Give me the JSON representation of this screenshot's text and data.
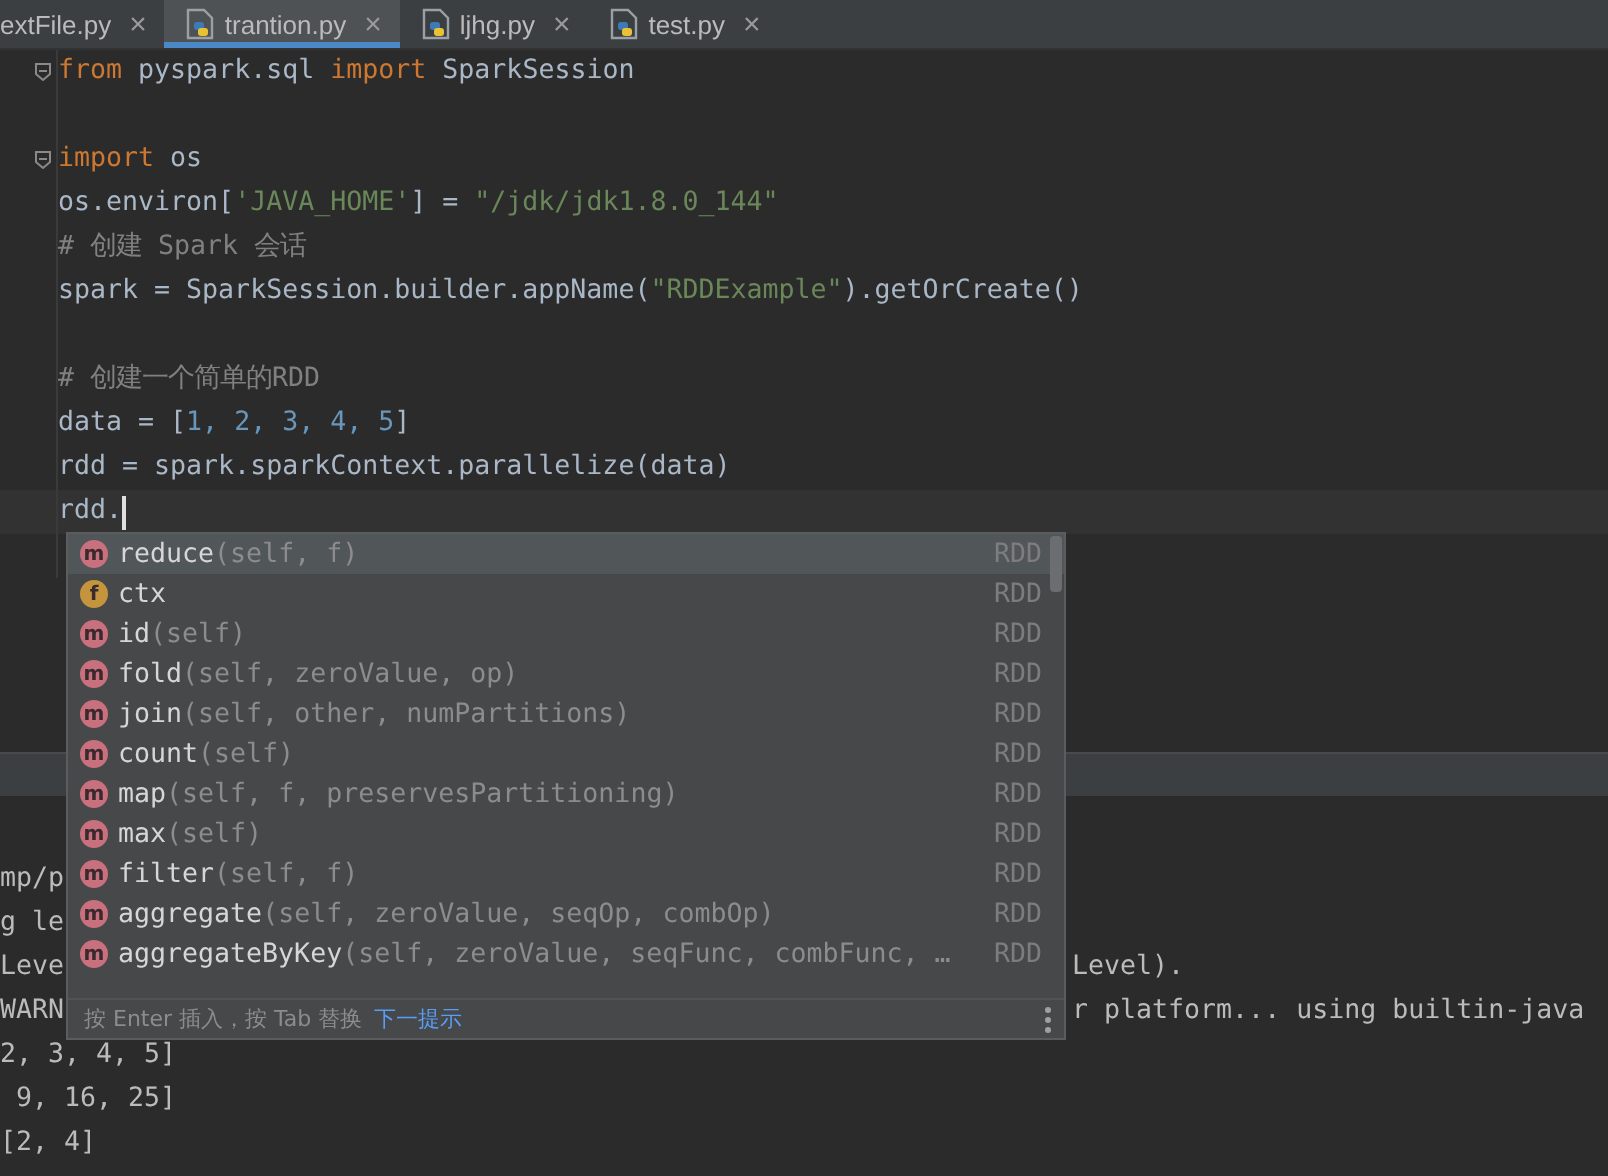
{
  "tabs": [
    {
      "label": "extFile.py",
      "has_icon": false,
      "selected": false
    },
    {
      "label": "trantion.py",
      "has_icon": true,
      "selected": true
    },
    {
      "label": "ljhg.py",
      "has_icon": true,
      "selected": false
    },
    {
      "label": "test.py",
      "has_icon": true,
      "selected": false
    }
  ],
  "close_glyph": "×",
  "editor": {
    "lines": [
      {
        "fold": true,
        "current": false,
        "segments": [
          {
            "text": "from",
            "kind": "keyword"
          },
          {
            "text": " pyspark.sql ",
            "kind": "plain"
          },
          {
            "text": "import",
            "kind": "keyword"
          },
          {
            "text": " SparkSession",
            "kind": "plain"
          }
        ]
      },
      {
        "fold": false,
        "current": false
      },
      {
        "fold": true,
        "current": false,
        "segments": [
          {
            "text": "import",
            "kind": "keyword"
          },
          {
            "text": " os",
            "kind": "plain"
          }
        ]
      },
      {
        "fold": false,
        "current": false,
        "segments": [
          {
            "text": "os.environ[",
            "kind": "plain"
          },
          {
            "text": "'JAVA_HOME'",
            "kind": "string"
          },
          {
            "text": "] = ",
            "kind": "plain"
          },
          {
            "text": "\"/jdk/jdk1.8.0_144\"",
            "kind": "string"
          }
        ]
      },
      {
        "fold": false,
        "current": false,
        "segments": [
          {
            "text": "# 创建 Spark 会话",
            "kind": "comment"
          }
        ]
      },
      {
        "fold": false,
        "current": false,
        "segments": [
          {
            "text": "spark = SparkSession.builder.appName(",
            "kind": "plain"
          },
          {
            "text": "\"RDDExample\"",
            "kind": "string"
          },
          {
            "text": ").getOrCreate()",
            "kind": "plain"
          }
        ]
      },
      {
        "fold": false,
        "current": false
      },
      {
        "fold": false,
        "current": false,
        "segments": [
          {
            "text": "# 创建一个简单的RDD",
            "kind": "comment"
          }
        ]
      },
      {
        "fold": false,
        "current": false,
        "segments": [
          {
            "text": "data = [",
            "kind": "plain"
          },
          {
            "text": "1, 2, 3, 4, 5",
            "kind": "number"
          },
          {
            "text": "]",
            "kind": "plain"
          }
        ]
      },
      {
        "fold": false,
        "current": false,
        "segments": [
          {
            "text": "rdd = spark.sparkContext.parallelize(data)",
            "kind": "plain"
          }
        ]
      },
      {
        "fold": false,
        "current": true,
        "segments": [
          {
            "text": "rdd.",
            "kind": "plain"
          }
        ]
      },
      {
        "fold": false,
        "current": false
      }
    ]
  },
  "console": {
    "lines": [
      {
        "left": "mp/p"
      },
      {
        "left": "g le"
      },
      {
        "left": "Leve",
        "right": "Level)."
      },
      {
        "left": "WARN",
        "right": "r platform... using builtin-java"
      },
      {
        "left": "2, 3, 4, 5]"
      },
      {
        "left": " 9, 16, 25]"
      },
      {
        "left": "[2, 4]"
      }
    ]
  },
  "completion": {
    "items": [
      {
        "kind": "method",
        "badge": "m",
        "name": "reduce",
        "params": "(self, f)",
        "type": "RDD",
        "selected": true
      },
      {
        "kind": "field",
        "badge": "f",
        "name": "ctx",
        "type": "RDD",
        "selected": false
      },
      {
        "kind": "method",
        "badge": "m",
        "name": "id",
        "params": "(self)",
        "type": "RDD",
        "selected": false
      },
      {
        "kind": "method",
        "badge": "m",
        "name": "fold",
        "params": "(self, zeroValue, op)",
        "type": "RDD",
        "selected": false
      },
      {
        "kind": "method",
        "badge": "m",
        "name": "join",
        "params": "(self, other, numPartitions)",
        "type": "RDD",
        "selected": false
      },
      {
        "kind": "method",
        "badge": "m",
        "name": "count",
        "params": "(self)",
        "type": "RDD",
        "selected": false
      },
      {
        "kind": "method",
        "badge": "m",
        "name": "map",
        "params": "(self, f, preservesPartitioning)",
        "type": "RDD",
        "selected": false
      },
      {
        "kind": "method",
        "badge": "m",
        "name": "max",
        "params": "(self)",
        "type": "RDD",
        "selected": false
      },
      {
        "kind": "method",
        "badge": "m",
        "name": "filter",
        "params": "(self, f)",
        "type": "RDD",
        "selected": false
      },
      {
        "kind": "method",
        "badge": "m",
        "name": "aggregate",
        "params": "(self, zeroValue, seqOp, combOp)",
        "type": "RDD",
        "selected": false
      },
      {
        "kind": "method",
        "badge": "m",
        "name": "aggregateByKey",
        "params": "(self, zeroValue, seqFunc, combFunc, …",
        "type": "RDD",
        "selected": false
      }
    ],
    "hint": "按 Enter 插入，按 Tab 替换",
    "link": "下一提示"
  }
}
